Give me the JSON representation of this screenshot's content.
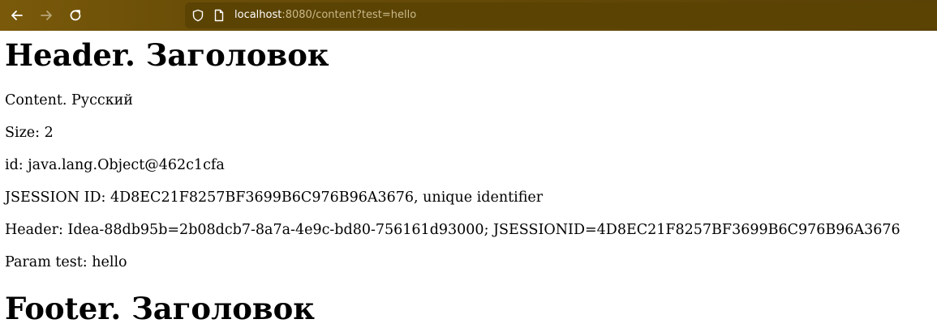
{
  "browser": {
    "url_host": "localhost",
    "url_rest": ":8080/content?test=hello",
    "icons": {
      "back": "back-arrow-icon",
      "forward": "forward-arrow-icon",
      "reload": "reload-icon",
      "shield": "shield-icon",
      "page": "page-icon"
    },
    "colors": {
      "toolbar": "#6a4e08",
      "urlbar": "#5b4304"
    }
  },
  "page": {
    "header_title": "Header. Заголовок",
    "content_line": "Content. Русский",
    "size_line": "Size: 2",
    "id_line": "id: java.lang.Object@462c1cfa",
    "jsession_line": "JSESSION ID: 4D8EC21F8257BF3699B6C976B96A3676, unique identifier",
    "header_line": "Header: Idea-88db95b=2b08dcb7-8a7a-4e9c-bd80-756161d93000; JSESSIONID=4D8EC21F8257BF3699B6C976B96A3676",
    "param_line": "Param test: hello",
    "footer_title": "Footer. Заголовок"
  }
}
